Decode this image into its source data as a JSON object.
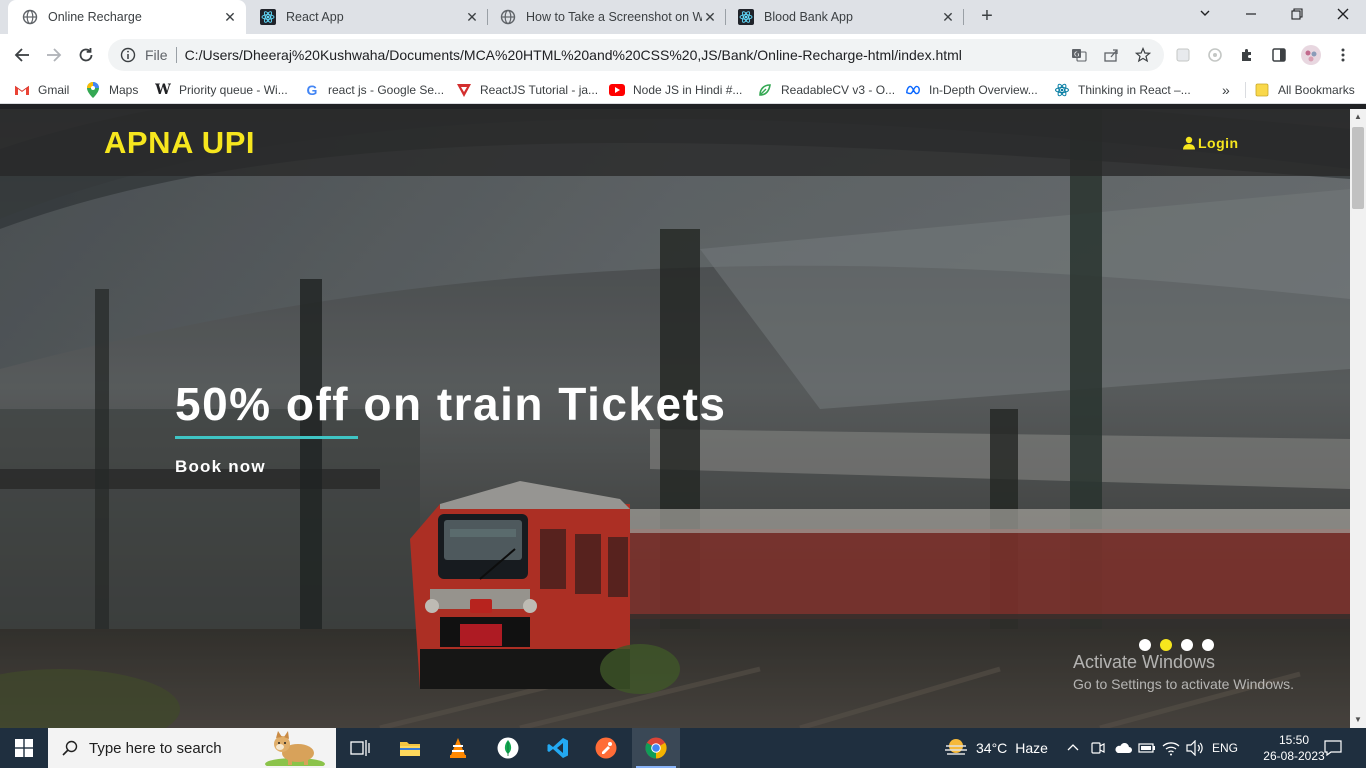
{
  "browser": {
    "tabs": [
      {
        "title": "Online Recharge",
        "icon": "globe-icon",
        "active": true
      },
      {
        "title": "React App",
        "icon": "react-icon",
        "active": false
      },
      {
        "title": "How to Take a Screenshot on Wi",
        "icon": "globe-icon",
        "active": false
      },
      {
        "title": "Blood Bank App",
        "icon": "react-icon",
        "active": false
      }
    ],
    "new_tab_label": "+",
    "close_glyph": "✕",
    "omnibox": {
      "scheme_label": "File",
      "url": "C:/Users/Dheeraj%20Kushwaha/Documents/MCA%20HTML%20and%20CSS%20,JS/Bank/Online-Recharge-html/index.html"
    },
    "bookmarks": [
      {
        "label": "Gmail",
        "icon": "gmail-icon"
      },
      {
        "label": "Maps",
        "icon": "maps-icon"
      },
      {
        "label": "Priority queue - Wi...",
        "icon": "wikipedia-icon"
      },
      {
        "label": "react js - Google Se...",
        "icon": "google-icon"
      },
      {
        "label": "ReactJS Tutorial - ja...",
        "icon": "javatpoint-icon"
      },
      {
        "label": "Node JS in Hindi #...",
        "icon": "youtube-icon"
      },
      {
        "label": "ReadableCV v3 - O...",
        "icon": "readablecv-icon"
      },
      {
        "label": "In-Depth Overview...",
        "icon": "meta-icon"
      },
      {
        "label": "Thinking in React –...",
        "icon": "react-icon"
      }
    ],
    "bookmarks_overflow": "»",
    "all_bookmarks_label": "All Bookmarks"
  },
  "page": {
    "brand": "APNA UPI",
    "login_label": "Login",
    "slide": {
      "title": "50% off on train Tickets",
      "cta": "Book now"
    },
    "slider_dots": 4,
    "active_dot": 2
  },
  "watermark": {
    "line1": "Activate Windows",
    "line2": "Go to Settings to activate Windows."
  },
  "taskbar": {
    "search_placeholder": "Type here to search",
    "weather": {
      "temp": "34°C",
      "condition": "Haze"
    },
    "language": "ENG",
    "time": "15:50",
    "date": "26-08-2023"
  },
  "colors": {
    "brand_yellow": "#f6e61e",
    "underline_teal": "#3fc4c4",
    "taskbar_bg": "#1f2f3f"
  }
}
